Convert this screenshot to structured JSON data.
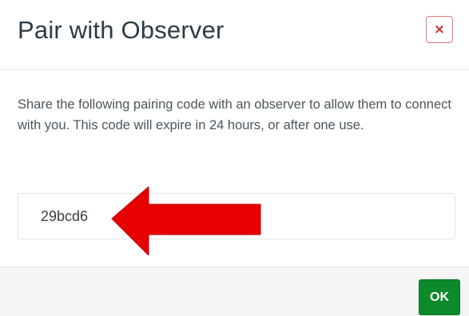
{
  "dialog": {
    "title": "Pair with Observer",
    "close_label": "×",
    "description": "Share the following pairing code with an observer to allow them to connect with you. This code will expire in 24 hours, or after one use.",
    "pairing_code": "29bcd6",
    "ok_label": "OK"
  },
  "annotation": {
    "arrow_icon": "red-arrow-icon",
    "arrow_color": "#e60000"
  },
  "colors": {
    "ok_button": "#0c8a2c",
    "close_border": "#e37a7a",
    "close_glyph": "#c93333"
  }
}
